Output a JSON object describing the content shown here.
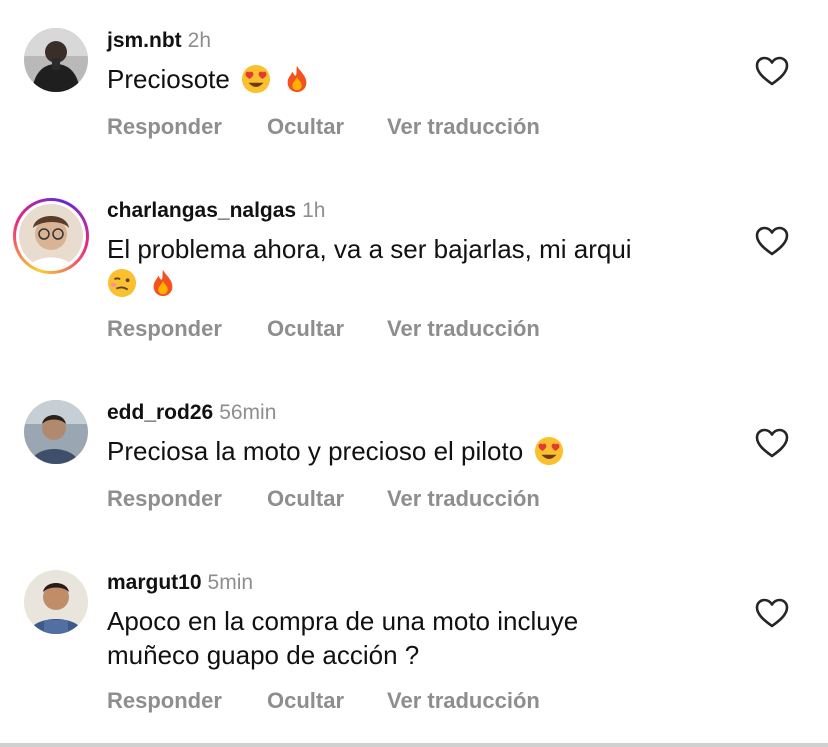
{
  "actions": {
    "reply": "Responder",
    "hide": "Ocultar",
    "translate": "Ver traducción"
  },
  "comments": [
    {
      "username": "jsm.nbt",
      "time": "2h",
      "text": "Preciosote",
      "emojis": [
        "heart-eyes-emoji",
        "fire-emoji"
      ],
      "has_story": false
    },
    {
      "username": "charlangas_nalgas",
      "time": "1h",
      "text": "El problema ahora, va a ser bajarlas, mi arqui",
      "emojis": [
        "woozy-face-emoji",
        "fire-emoji"
      ],
      "has_story": true
    },
    {
      "username": "edd_rod26",
      "time": "56min",
      "text": "Preciosa la moto y precioso el piloto",
      "emojis": [
        "heart-eyes-emoji"
      ],
      "has_story": false
    },
    {
      "username": "margut10",
      "time": "5min",
      "text": "Apoco en la compra de una moto incluye muñeco guapo de acción ?",
      "emojis": [],
      "has_story": false
    }
  ],
  "colors": {
    "secondary_text": "#8e8e8e",
    "primary_text": "#111111",
    "background": "#ffffff"
  }
}
